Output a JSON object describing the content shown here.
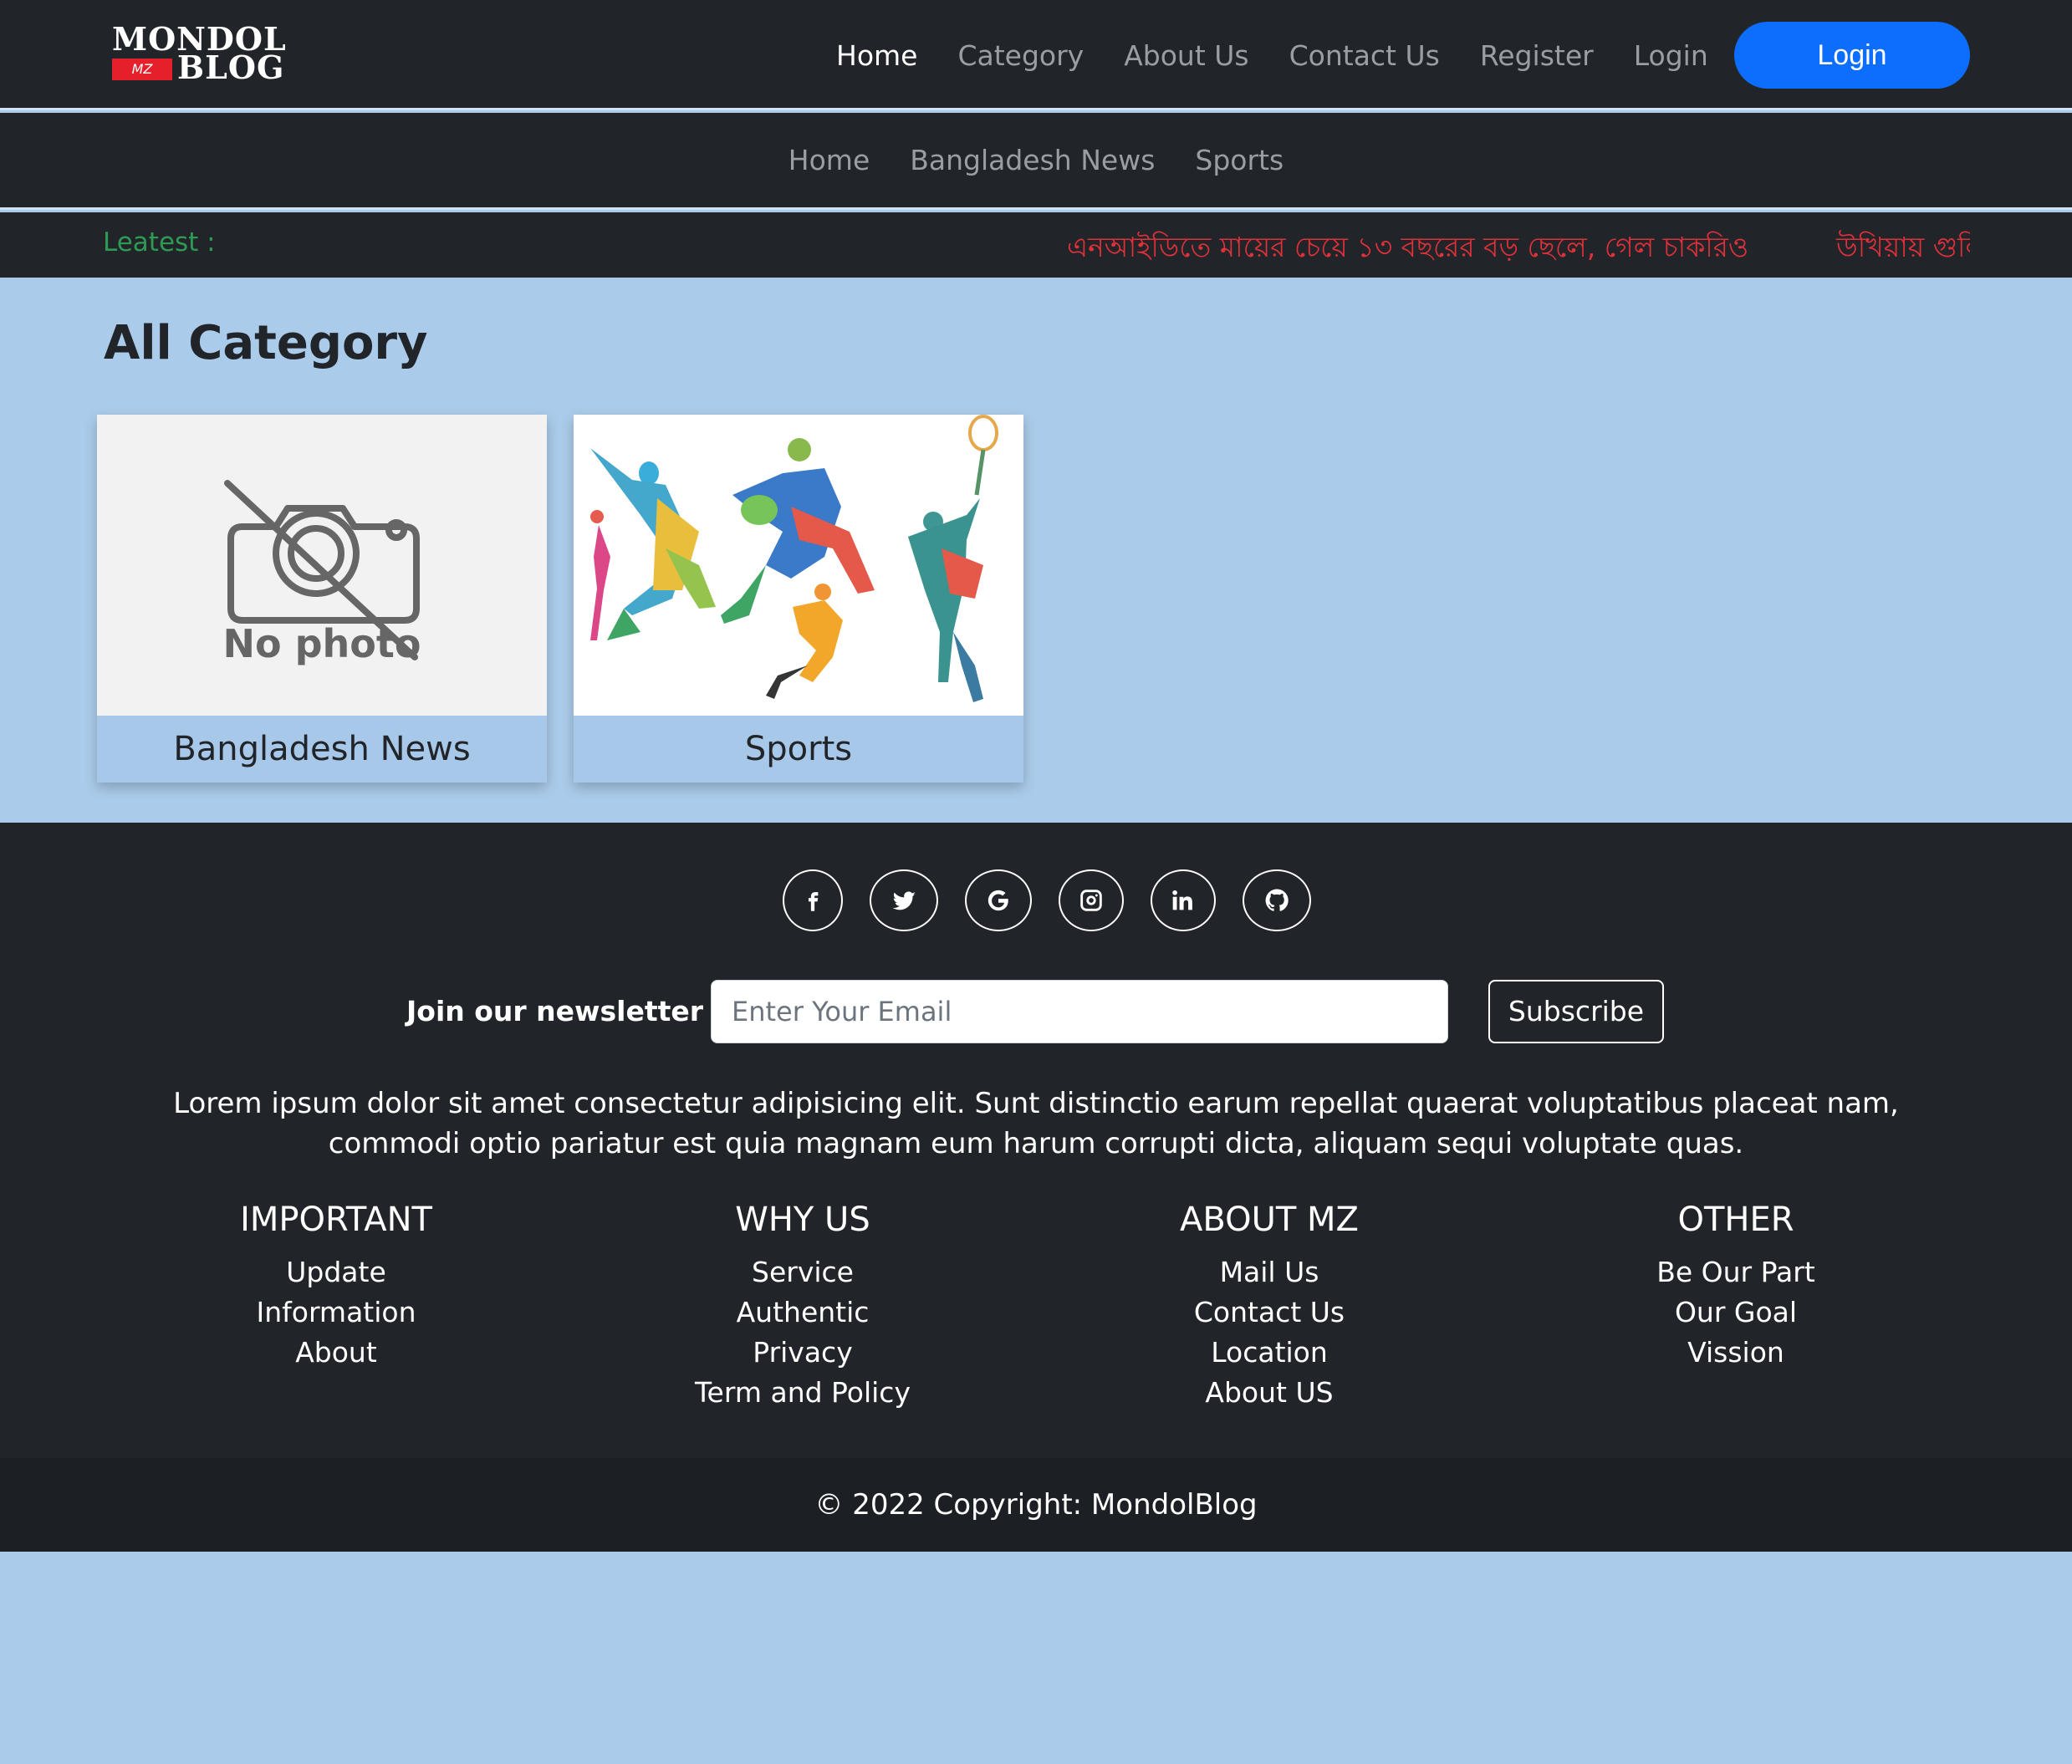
{
  "brand": {
    "name_line1": "MONDOL",
    "name_line2": "BLOG",
    "badge": "MZ"
  },
  "topnav": {
    "links": [
      "Home",
      "Category",
      "About Us",
      "Contact Us",
      "Register",
      "Login"
    ],
    "active": "Home",
    "login_button": "Login"
  },
  "catnav": {
    "links": [
      "Home",
      "Bangladesh News",
      "Sports"
    ]
  },
  "ticker": {
    "label": "Leatest :",
    "items": [
      "এনআইডিতে মায়ের চেয়ে ১৩ বছরের বড় ছেলে, গেল চাকরিও",
      "উখিয়ায় গুলি"
    ]
  },
  "main": {
    "title": "All Category",
    "cards": [
      {
        "caption": "Bangladesh News",
        "image": "no-photo",
        "image_text": "No photo"
      },
      {
        "caption": "Sports",
        "image": "sports-silhouettes"
      }
    ]
  },
  "footer": {
    "socials": [
      "facebook-icon",
      "twitter-icon",
      "google-icon",
      "instagram-icon",
      "linkedin-icon",
      "github-icon"
    ],
    "newsletter_label": "Join our newsletter",
    "email_placeholder": "Enter Your Email",
    "subscribe_label": "Subscribe",
    "lorem": "Lorem ipsum dolor sit amet consectetur adipisicing elit. Sunt distinctio earum repellat quaerat voluptatibus placeat nam, commodi optio pariatur est quia magnam eum harum corrupti dicta, aliquam sequi voluptate quas.",
    "columns": [
      {
        "title": "IMPORTANT",
        "links": [
          "Update",
          "Information",
          "About"
        ]
      },
      {
        "title": "WHY US",
        "links": [
          "Service",
          "Authentic",
          "Privacy",
          "Term and Policy"
        ]
      },
      {
        "title": "ABOUT MZ",
        "links": [
          "Mail Us",
          "Contact Us",
          "Location",
          "About US"
        ]
      },
      {
        "title": "OTHER",
        "links": [
          "Be Our Part",
          "Our Goal",
          "Vission"
        ]
      }
    ],
    "copyright": "© 2022 Copyright: MondolBlog"
  },
  "colors": {
    "page_bg": "#aacbea",
    "nav_bg": "#212529",
    "accent": "#0d6efd",
    "ticker_label": "#2e9a53",
    "ticker_text": "#e0303a"
  }
}
